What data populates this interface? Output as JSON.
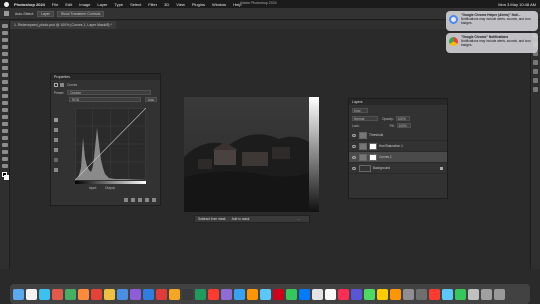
{
  "menubar": {
    "apple": "",
    "items": [
      "Photoshop 2024",
      "File",
      "Edit",
      "Image",
      "Layer",
      "Type",
      "Select",
      "Filter",
      "3D",
      "View",
      "Plugins",
      "Window",
      "Help"
    ],
    "app_title": "Adobe Photoshop 2024",
    "clock": "Mon 3 May  10:48 AM"
  },
  "options": {
    "auto_select_label": "Auto-Select:",
    "auto_select_value": "Layer",
    "show_transform": "Show Transform Controls"
  },
  "document_tab": "1. Redevepsed_photo.psd @ 100% (Curves 1, Layer Mask/8) *",
  "properties": {
    "title": "Properties",
    "section": "Curves",
    "preset_label": "Preset:",
    "preset_value": "Custom",
    "channel_value": "RGB",
    "auto_label": "Auto",
    "input_label": "Input:",
    "output_label": "Output:"
  },
  "canvas_bar": {
    "item1": "Subtract from mask",
    "item2": "Add to mask"
  },
  "layers": {
    "title": "Layers",
    "kind_label": "Kind",
    "blend_mode": "Normal",
    "opacity_label": "Opacity:",
    "opacity_value": "100%",
    "lock_label": "Lock:",
    "fill_label": "Fill:",
    "fill_value": "100%",
    "rows": [
      "Threshold",
      "Hue/Saturation 1",
      "Curves 1",
      "Background"
    ]
  },
  "notifications": [
    {
      "title": "\"Google Chrome Helper (Alerts)\" Noti...",
      "body": "Notifications may include alerts, sounds, and icon badges."
    },
    {
      "title": "\"Google Chrome\" Notifications",
      "body": "Notifications may include alerts, sounds, and icon badges."
    }
  ],
  "dock_colors": [
    "#5aa9f0",
    "#f2f2f2",
    "#3cc0f0",
    "#e05a4a",
    "#45b062",
    "#ff8a3d",
    "#e34234",
    "#f0c040",
    "#4a90e2",
    "#8e5cd9",
    "#2f7de1",
    "#e13a3a",
    "#f5a623",
    "#3a3a3a",
    "#1f9c5b",
    "#ff3b30",
    "#8f6bd6",
    "#38a1f3",
    "#ff9500",
    "#5ac8fa",
    "#d0021b",
    "#34c759",
    "#007aff",
    "#e4e4e4",
    "#fafafa",
    "#ff2d55",
    "#5856d6",
    "#4cd964",
    "#ffcc00",
    "#ff9500",
    "#8e8e93",
    "#6f6f6f",
    "#ff3b30",
    "#5ac8fa",
    "#34c759",
    "#c0c0c0",
    "#a0a0a0",
    "#999"
  ]
}
